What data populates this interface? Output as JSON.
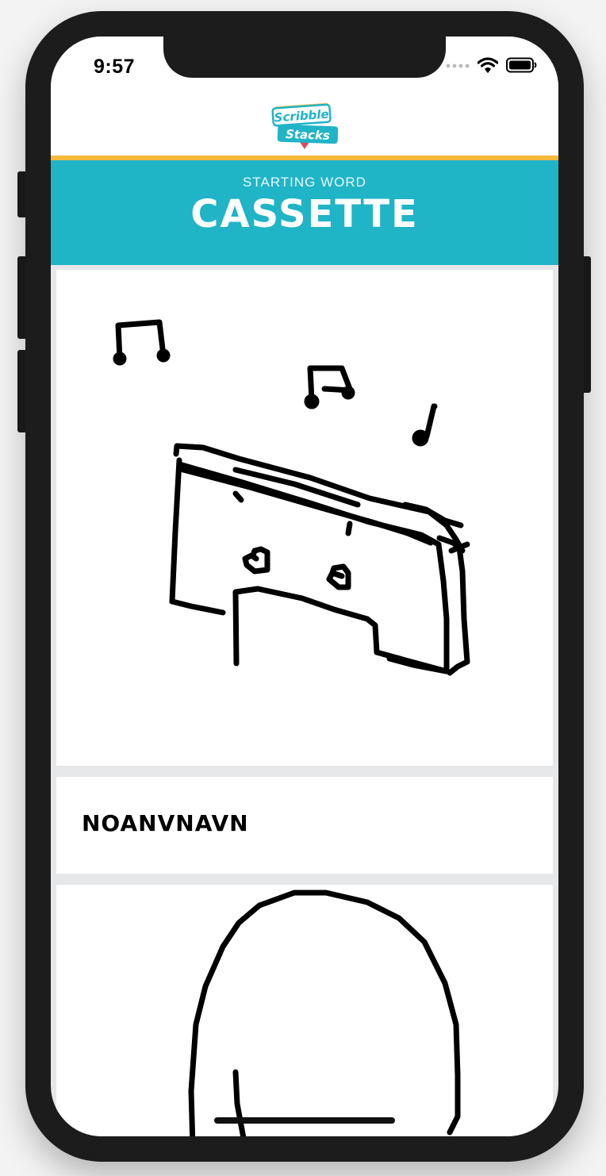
{
  "status_bar": {
    "time": "9:57",
    "signal_icon": "signal-dots-icon",
    "wifi_icon": "wifi-icon",
    "battery_icon": "battery-icon"
  },
  "header": {
    "logo_line1": "Scribble",
    "logo_line2": "Stacks",
    "colors": {
      "teal": "#20b4c7",
      "gold": "#f6b93b",
      "logo_red": "#e04a5a"
    }
  },
  "banner": {
    "label": "STARTING WORD",
    "word": "CASSETTE"
  },
  "stack": [
    {
      "type": "drawing",
      "subject": "cassette-drawing"
    },
    {
      "type": "guess",
      "text": "NOANVNAVN"
    },
    {
      "type": "drawing",
      "subject": "oval-head-drawing"
    }
  ]
}
